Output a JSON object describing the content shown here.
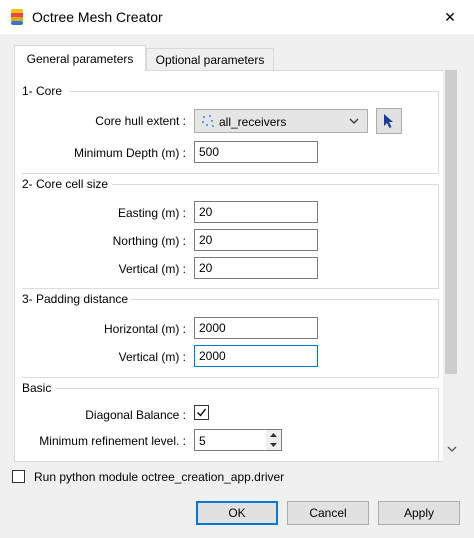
{
  "window": {
    "title": "Octree Mesh Creator",
    "close_glyph": "✕"
  },
  "tabs": [
    {
      "label": "General parameters"
    },
    {
      "label": "Optional parameters"
    }
  ],
  "core": {
    "title": "1- Core",
    "hull_label": "Core hull extent :",
    "hull_value": "all_receivers",
    "depth_label": "Minimum Depth (m) :",
    "depth_value": "500"
  },
  "cell_size": {
    "title": "2- Core cell size",
    "easting_label": "Easting (m) :",
    "easting_value": "20",
    "northing_label": "Northing (m) :",
    "northing_value": "20",
    "vertical_label": "Vertical (m) :",
    "vertical_value": "20"
  },
  "padding": {
    "title": "3- Padding distance",
    "horizontal_label": "Horizontal (m) :",
    "horizontal_value": "2000",
    "vertical_label": "Vertical (m) :",
    "vertical_value": "2000"
  },
  "basic": {
    "title": "Basic",
    "diagonal_label": "Diagonal Balance :",
    "diagonal_checked": true,
    "refinement_label": "Minimum refinement level. :",
    "refinement_value": "5"
  },
  "footer": {
    "run_label": "Run python module octree_creation_app.driver",
    "ok_label": "OK",
    "cancel_label": "Cancel",
    "apply_label": "Apply"
  },
  "colors": {
    "accent": "#0078d7",
    "cursor_icon": "#1a3d9c"
  }
}
